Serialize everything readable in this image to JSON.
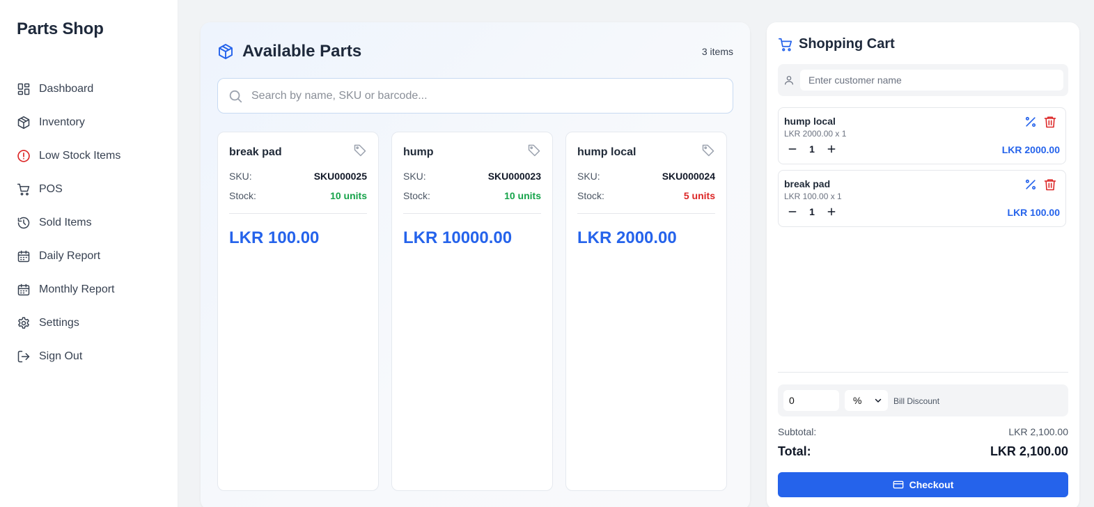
{
  "app": {
    "brand": "Parts Shop"
  },
  "sidebar": {
    "items": [
      {
        "label": "Dashboard",
        "icon": "dashboard-icon"
      },
      {
        "label": "Inventory",
        "icon": "box-icon"
      },
      {
        "label": "Low Stock Items",
        "icon": "alert-circle-icon"
      },
      {
        "label": "POS",
        "icon": "cart-icon"
      },
      {
        "label": "Sold Items",
        "icon": "history-icon"
      },
      {
        "label": "Daily Report",
        "icon": "calendar-icon"
      },
      {
        "label": "Monthly Report",
        "icon": "calendar-icon"
      },
      {
        "label": "Settings",
        "icon": "gear-icon"
      },
      {
        "label": "Sign Out",
        "icon": "logout-icon"
      }
    ]
  },
  "parts": {
    "title": "Available Parts",
    "count": "3 items",
    "search_placeholder": "Search by name, SKU or barcode...",
    "sku_label": "SKU:",
    "stock_label": "Stock:",
    "cards": [
      {
        "name": "break pad",
        "sku": "SKU000025",
        "stock": "10 units",
        "stock_status": "ok",
        "price": "LKR 100.00"
      },
      {
        "name": "hump",
        "sku": "SKU000023",
        "stock": "10 units",
        "stock_status": "ok",
        "price": "LKR 10000.00"
      },
      {
        "name": "hump local",
        "sku": "SKU000024",
        "stock": "5 units",
        "stock_status": "low",
        "price": "LKR 2000.00"
      }
    ]
  },
  "cart": {
    "title": "Shopping Cart",
    "customer_placeholder": "Enter customer name",
    "items": [
      {
        "name": "hump local",
        "detail": "LKR 2000.00 x 1",
        "qty": "1",
        "total": "LKR 2000.00"
      },
      {
        "name": "break pad",
        "detail": "LKR 100.00 x 1",
        "qty": "1",
        "total": "LKR 100.00"
      }
    ],
    "discount": {
      "value": "0",
      "type": "%",
      "label": "Bill Discount"
    },
    "subtotal_label": "Subtotal:",
    "subtotal": "LKR 2,100.00",
    "total_label": "Total:",
    "total": "LKR 2,100.00",
    "checkout_label": "Checkout"
  },
  "colors": {
    "accent": "#2563eb",
    "stock_ok": "#16a34a",
    "stock_low": "#dc2626",
    "alert": "#dc2626"
  }
}
